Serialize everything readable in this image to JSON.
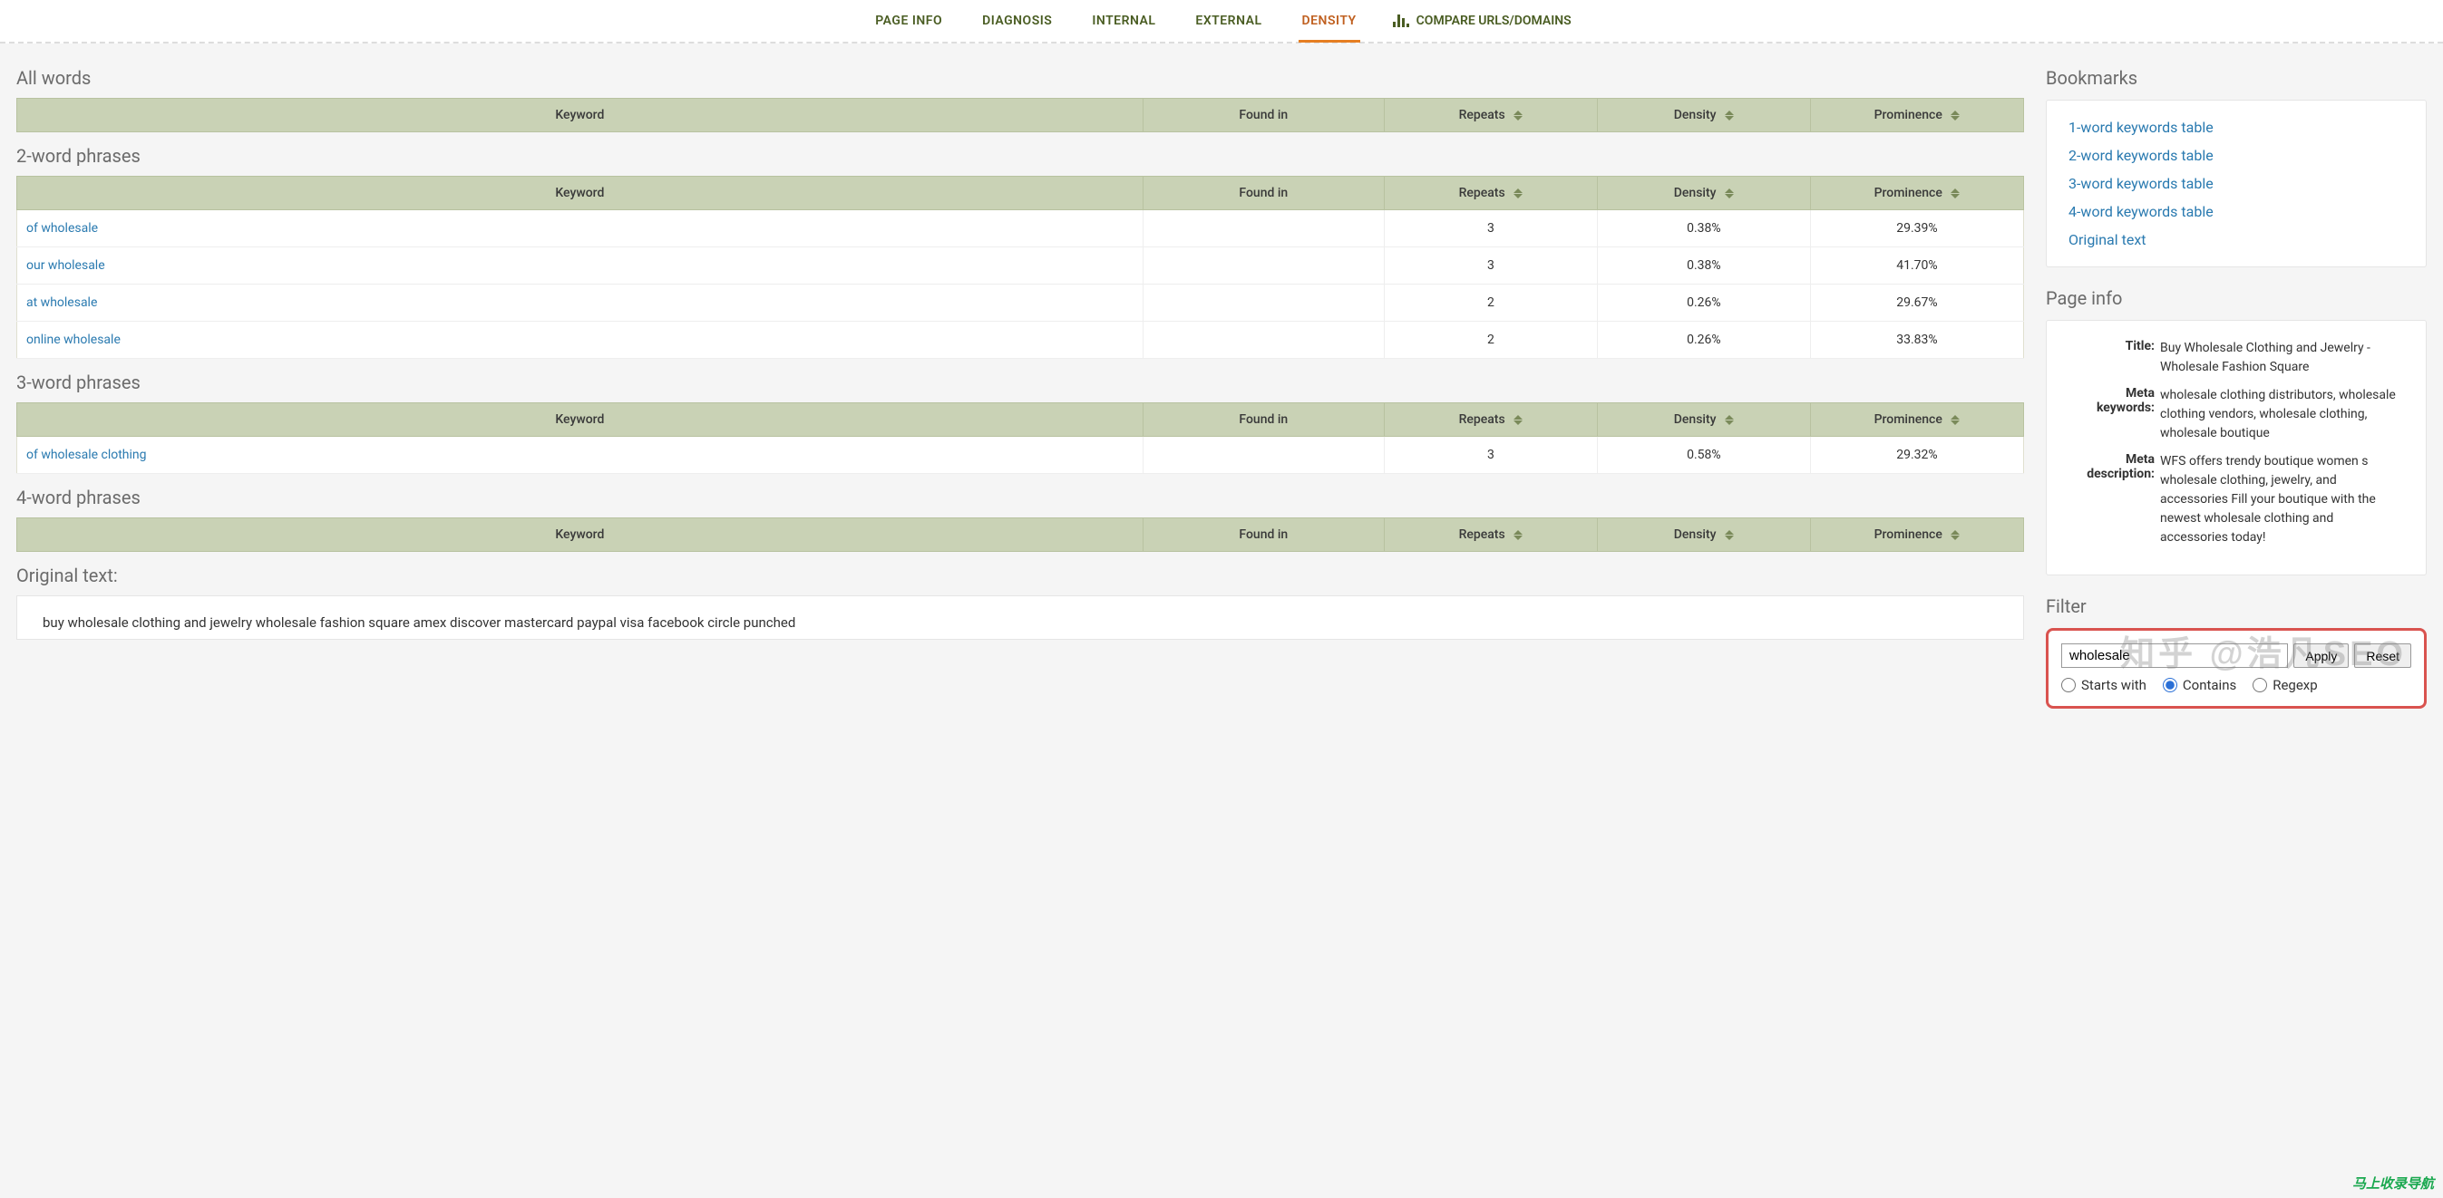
{
  "nav": {
    "tabs": [
      "PAGE INFO",
      "DIAGNOSIS",
      "INTERNAL",
      "EXTERNAL",
      "DENSITY"
    ],
    "active": "DENSITY",
    "compare": "COMPARE URLS/DOMAINS"
  },
  "headers": {
    "keyword": "Keyword",
    "found_in": "Found in",
    "repeats": "Repeats",
    "density": "Density",
    "prominence": "Prominence"
  },
  "sections": {
    "all_words": {
      "title": "All words",
      "rows": []
    },
    "two_word": {
      "title": "2-word phrases",
      "rows": [
        {
          "kw": "of wholesale",
          "found": "",
          "repeats": "3",
          "density": "0.38%",
          "prominence": "29.39%"
        },
        {
          "kw": "our wholesale",
          "found": "",
          "repeats": "3",
          "density": "0.38%",
          "prominence": "41.70%"
        },
        {
          "kw": "at wholesale",
          "found": "",
          "repeats": "2",
          "density": "0.26%",
          "prominence": "29.67%"
        },
        {
          "kw": "online wholesale",
          "found": "",
          "repeats": "2",
          "density": "0.26%",
          "prominence": "33.83%"
        }
      ]
    },
    "three_word": {
      "title": "3-word phrases",
      "rows": [
        {
          "kw": "of wholesale clothing",
          "found": "",
          "repeats": "3",
          "density": "0.58%",
          "prominence": "29.32%"
        }
      ]
    },
    "four_word": {
      "title": "4-word phrases",
      "rows": []
    },
    "original": {
      "title": "Original text:",
      "body": "buy wholesale clothing and jewelry   wholesale fashion square amex discover mastercard paypal visa facebook circle punched"
    }
  },
  "side": {
    "bookmarks_title": "Bookmarks",
    "bookmarks": [
      "1-word keywords table",
      "2-word keywords table",
      "3-word keywords table",
      "4-word keywords table",
      "Original text"
    ],
    "pageinfo_title": "Page info",
    "pageinfo": {
      "title_label": "Title:",
      "title_value": "Buy Wholesale Clothing and Jewelry - Wholesale Fashion Square",
      "mk_label": "Meta keywords:",
      "mk_value": "wholesale clothing distributors, wholesale clothing vendors, wholesale clothing, wholesale boutique",
      "md_label": "Meta description:",
      "md_value": "WFS offers trendy boutique women s wholesale clothing, jewelry, and accessories Fill your boutique with the newest wholesale clothing and accessories today!"
    },
    "filter_title": "Filter",
    "filter": {
      "value": "wholesale",
      "apply": "Apply",
      "reset": "Reset",
      "opt_starts": "Starts with",
      "opt_contains": "Contains",
      "opt_regexp": "Regexp",
      "selected": "contains"
    }
  },
  "watermark": "知乎 @浩凡SEO",
  "corner": "马上收录导航"
}
